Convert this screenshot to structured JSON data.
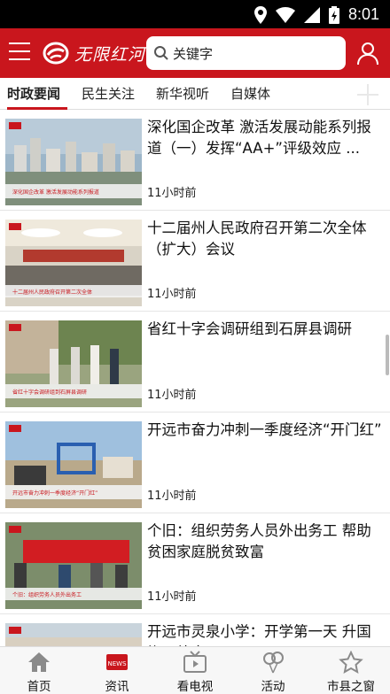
{
  "status_bar": {
    "time": "8:01"
  },
  "header": {
    "logo_text": "无限红河",
    "search_placeholder": "关键字"
  },
  "tabs": [
    {
      "label": "时政要闻",
      "active": true
    },
    {
      "label": "民生关注",
      "active": false
    },
    {
      "label": "新华视听",
      "active": false
    },
    {
      "label": "自媒体",
      "active": false
    }
  ],
  "articles": [
    {
      "title": "深化国企改革 激活发展动能系列报道（一）发挥“AA+”评级效应 ...",
      "time": "11小时前",
      "thumb_caption": "深化国企改革 激活发展动能系列报道"
    },
    {
      "title": "十二届州人民政府召开第二次全体（扩大）会议",
      "time": "11小时前",
      "thumb_caption": "十二届州人民政府召开第二次全体"
    },
    {
      "title": "省红十字会调研组到石屏县调研",
      "time": "11小时前",
      "thumb_caption": "省红十字会调研组到石屏县调研"
    },
    {
      "title": "开远市奋力冲刺一季度经济“开门红”",
      "time": "11小时前",
      "thumb_caption": "开远市奋力冲刺一季度经济“开门红”"
    },
    {
      "title": "个旧：组织劳务人员外出务工 帮助贫困家庭脱贫致富",
      "time": "11小时前",
      "thumb_caption": "个旧：组织劳务人员外出务工"
    },
    {
      "title": "开远市灵泉小学：开学第一天 升国旗强德育",
      "time": "",
      "thumb_caption": ""
    }
  ],
  "bottom_nav": [
    {
      "label": "首页",
      "icon": "home-icon"
    },
    {
      "label": "资讯",
      "icon": "news-icon",
      "active": true
    },
    {
      "label": "看电视",
      "icon": "tv-icon"
    },
    {
      "label": "活动",
      "icon": "balloon-icon"
    },
    {
      "label": "市县之窗",
      "icon": "star-icon"
    }
  ],
  "colors": {
    "brand": "#c9161d",
    "nav_bg": "#f7f7f7"
  }
}
